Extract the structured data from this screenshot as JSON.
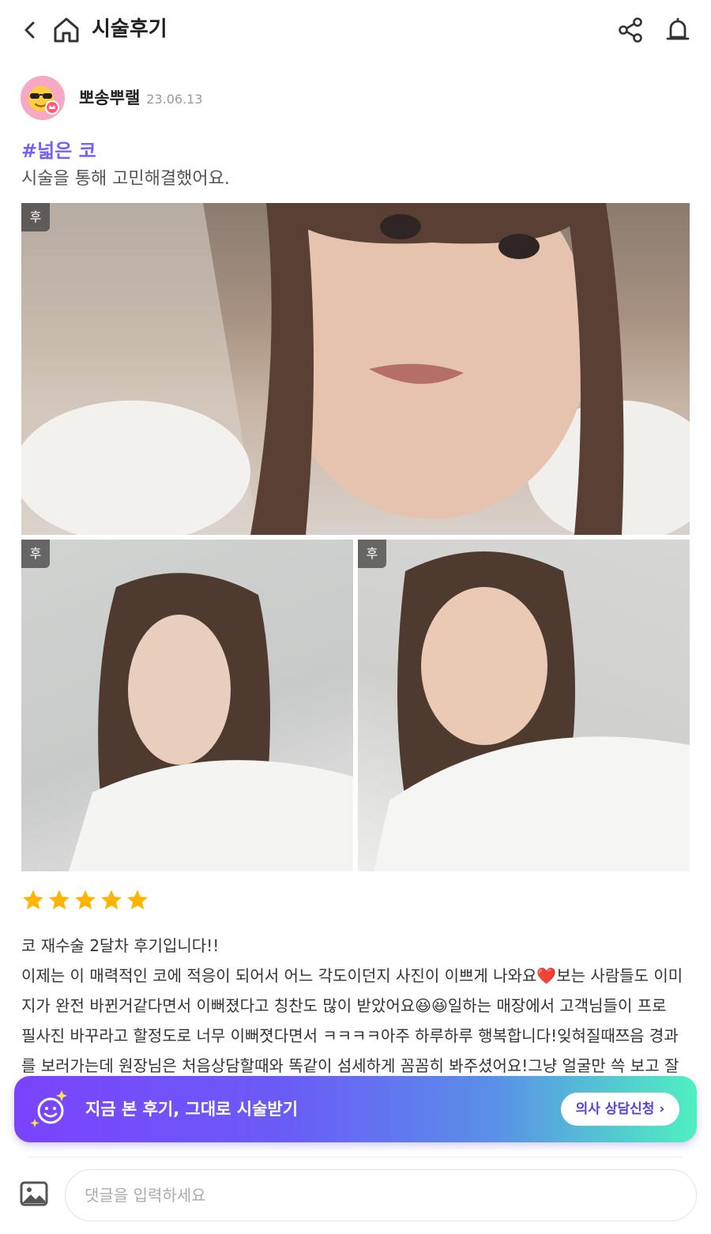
{
  "header": {
    "title": "시술후기",
    "icons": [
      "chevron-left-icon",
      "home-icon",
      "share-icon",
      "bell-icon"
    ]
  },
  "author": {
    "name": "뽀송뿌랠",
    "date": "23.06.13"
  },
  "post": {
    "tag": "#넓은 코",
    "summary": "시술을 통해 고민해결했어요.",
    "photos": [
      {
        "badge": "후"
      },
      {
        "badge": "후"
      },
      {
        "badge": "후"
      }
    ],
    "rating": 5,
    "body_lines": [
      "코 재수술 2달차 후기입니다!!",
      "이제는 이 매력적인 코에 적응이 되어서 어느 각도이던지 사진이 이쁘게 나와요❤️보는 사람들도 이미",
      "지가 완전 바뀐거같다면서 이뻐졌다고 칭찬도 많이 받았어요😆😆일하는 매장에서 고객님들이 프로",
      "필사진 바꾸라고 할정도로 너무 이뻐졋다면서 ㅋㅋㅋㅋ아주 하루하루 행복합니다!잊혀질때쯔음 경과",
      "를 보러가는데 원장님은 처음상담할때와 똑같이 섬세하게 꼼꼼히 봐주셨어요!그냥 얼굴만 쓱 보고 잘"
    ]
  },
  "cta": {
    "text": "지금 본 후기, 그대로 시술받기",
    "button_label": "의사 상담신청 ›"
  },
  "comment": {
    "placeholder": "댓글을 입력하세요",
    "value": ""
  },
  "colors": {
    "accent": "#7b5cff",
    "star": "#ffb400",
    "cta_gradient_start": "#7b43ff",
    "cta_gradient_end": "#4ff0c0"
  }
}
